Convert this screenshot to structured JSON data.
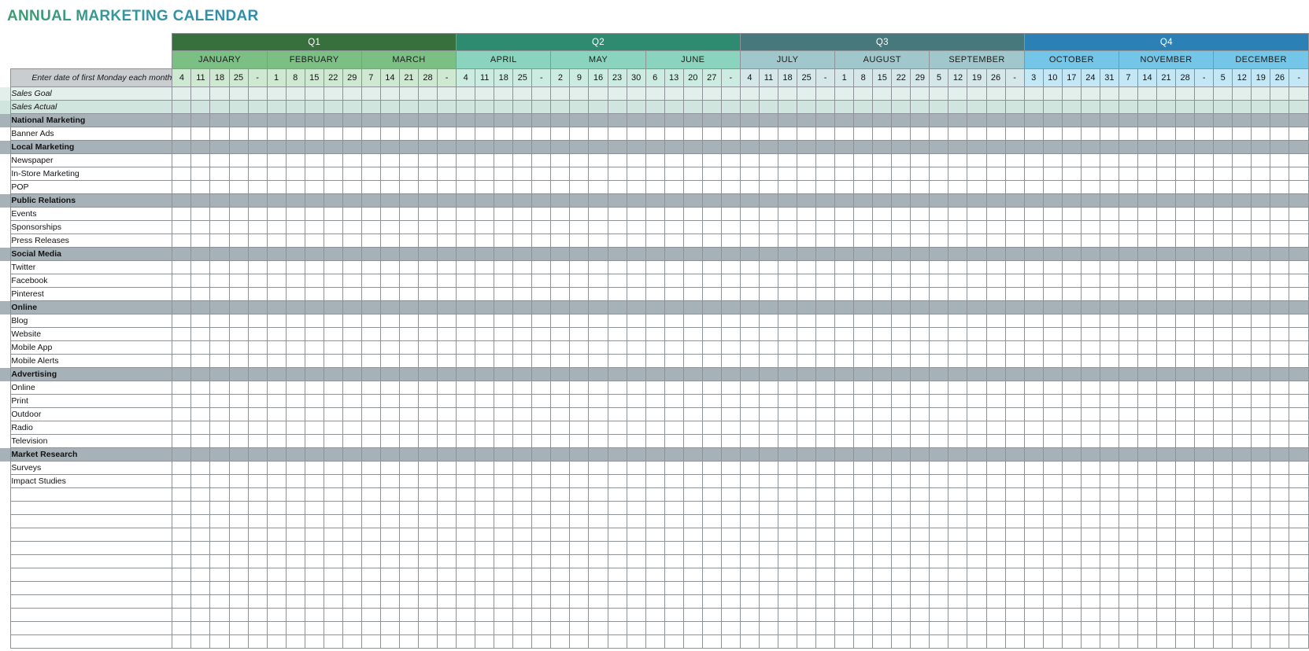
{
  "document": {
    "title": "ANNUAL MARKETING CALENDAR",
    "title_gradient_from": "#3a9d6d",
    "title_gradient_to": "#2e8bae"
  },
  "colors": {
    "q1": "#38703d",
    "q2": "#2e8b6f",
    "q3": "#46787c",
    "q4": "#2b81b5",
    "q1_month": "#7bbf84",
    "q2_month": "#8ad4bd",
    "q3_month": "#a0c8cc",
    "q4_month": "#73c6e8",
    "section_header": "#a6b2b8",
    "sales_goal": "#e2efeb",
    "sales_actual": "#cfe5de",
    "grid_line": "#8d9296"
  },
  "header": {
    "date_hint_label": "Enter date of first Monday each month",
    "quarters": [
      {
        "label": "Q1",
        "theme": "q1",
        "month_theme": "m1",
        "date_theme": "d1",
        "months": [
          {
            "name": "JANUARY",
            "dates": [
              "4",
              "11",
              "18",
              "25",
              "-"
            ]
          },
          {
            "name": "FEBRUARY",
            "dates": [
              "1",
              "8",
              "15",
              "22",
              "29"
            ]
          },
          {
            "name": "MARCH",
            "dates": [
              "7",
              "14",
              "21",
              "28",
              "-"
            ]
          }
        ]
      },
      {
        "label": "Q2",
        "theme": "q2",
        "month_theme": "m2",
        "date_theme": "d2",
        "months": [
          {
            "name": "APRIL",
            "dates": [
              "4",
              "11",
              "18",
              "25",
              "-"
            ]
          },
          {
            "name": "MAY",
            "dates": [
              "2",
              "9",
              "16",
              "23",
              "30"
            ]
          },
          {
            "name": "JUNE",
            "dates": [
              "6",
              "13",
              "20",
              "27",
              "-"
            ]
          }
        ]
      },
      {
        "label": "Q3",
        "theme": "q3",
        "month_theme": "m3",
        "date_theme": "d3",
        "months": [
          {
            "name": "JULY",
            "dates": [
              "4",
              "11",
              "18",
              "25",
              "-"
            ]
          },
          {
            "name": "AUGUST",
            "dates": [
              "1",
              "8",
              "15",
              "22",
              "29"
            ]
          },
          {
            "name": "SEPTEMBER",
            "dates": [
              "5",
              "12",
              "19",
              "26",
              "-"
            ]
          }
        ]
      },
      {
        "label": "Q4",
        "theme": "q4",
        "month_theme": "m4",
        "date_theme": "d4",
        "months": [
          {
            "name": "OCTOBER",
            "dates": [
              "3",
              "10",
              "17",
              "24",
              "31"
            ]
          },
          {
            "name": "NOVEMBER",
            "dates": [
              "7",
              "14",
              "21",
              "28",
              "-"
            ]
          },
          {
            "name": "DECEMBER",
            "dates": [
              "5",
              "12",
              "19",
              "26",
              "-"
            ]
          }
        ]
      }
    ]
  },
  "rows": [
    {
      "label": "Sales Goal",
      "type": "sales-goal"
    },
    {
      "label": "Sales Actual",
      "type": "sales-actual"
    },
    {
      "label": "National Marketing",
      "type": "section"
    },
    {
      "label": "Banner Ads",
      "type": "item"
    },
    {
      "label": "Local Marketing",
      "type": "section"
    },
    {
      "label": "Newspaper",
      "type": "item"
    },
    {
      "label": "In-Store Marketing",
      "type": "item"
    },
    {
      "label": "POP",
      "type": "item"
    },
    {
      "label": "Public Relations",
      "type": "section"
    },
    {
      "label": "Events",
      "type": "item"
    },
    {
      "label": "Sponsorships",
      "type": "item"
    },
    {
      "label": "Press Releases",
      "type": "item"
    },
    {
      "label": "Social Media",
      "type": "section"
    },
    {
      "label": "Twitter",
      "type": "item"
    },
    {
      "label": "Facebook",
      "type": "item"
    },
    {
      "label": "Pinterest",
      "type": "item"
    },
    {
      "label": "Online",
      "type": "section"
    },
    {
      "label": "Blog",
      "type": "item"
    },
    {
      "label": "Website",
      "type": "item"
    },
    {
      "label": "Mobile App",
      "type": "item"
    },
    {
      "label": "Mobile Alerts",
      "type": "item"
    },
    {
      "label": "Advertising",
      "type": "section"
    },
    {
      "label": "Online",
      "type": "item"
    },
    {
      "label": "Print",
      "type": "item"
    },
    {
      "label": "Outdoor",
      "type": "item"
    },
    {
      "label": "Radio",
      "type": "item"
    },
    {
      "label": "Television",
      "type": "item"
    },
    {
      "label": "Market Research",
      "type": "section"
    },
    {
      "label": "Surveys",
      "type": "item"
    },
    {
      "label": "Impact Studies",
      "type": "item"
    },
    {
      "label": "",
      "type": "blank"
    },
    {
      "label": "",
      "type": "blank"
    },
    {
      "label": "",
      "type": "blank"
    },
    {
      "label": "",
      "type": "blank"
    },
    {
      "label": "",
      "type": "blank"
    },
    {
      "label": "",
      "type": "blank"
    },
    {
      "label": "",
      "type": "blank"
    },
    {
      "label": "",
      "type": "blank"
    },
    {
      "label": "",
      "type": "blank"
    },
    {
      "label": "",
      "type": "blank"
    },
    {
      "label": "",
      "type": "blank"
    },
    {
      "label": "",
      "type": "blank"
    }
  ]
}
